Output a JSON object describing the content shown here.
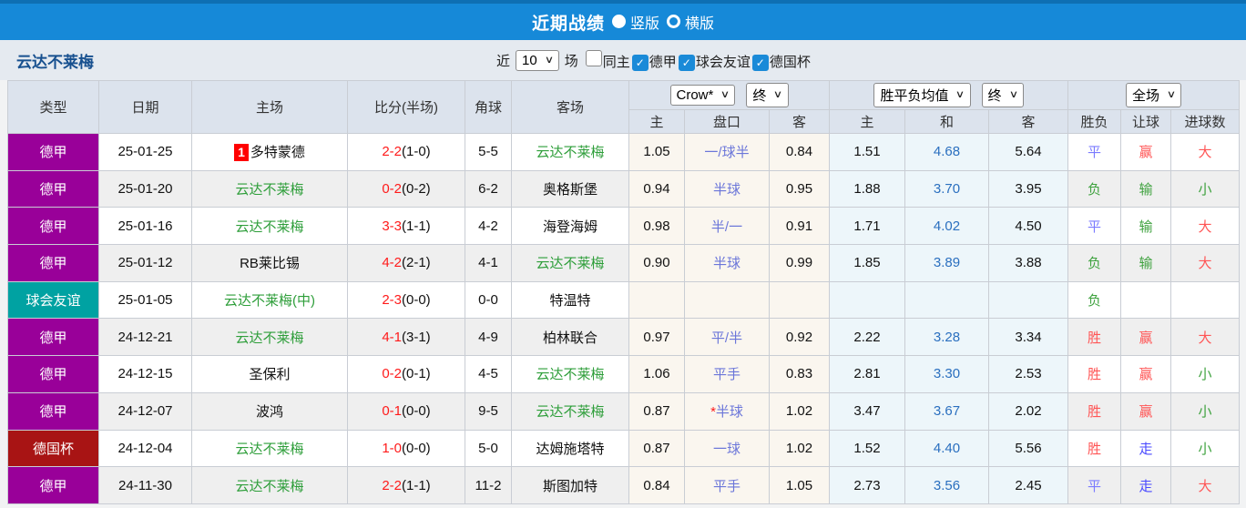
{
  "topbar": {
    "title": "近期战绩",
    "options": [
      {
        "label": "竖版",
        "selected": false
      },
      {
        "label": "横版",
        "selected": true
      }
    ]
  },
  "subheader": {
    "team": "云达不莱梅",
    "near_label": "近",
    "count_value": "10",
    "unit_label": "场",
    "filters": [
      {
        "label": "同主",
        "checked": false
      },
      {
        "label": "德甲",
        "checked": true
      },
      {
        "label": "球会友谊",
        "checked": true
      },
      {
        "label": "德国杯",
        "checked": true
      }
    ]
  },
  "table": {
    "selects": {
      "company": "Crow*",
      "final1": "终",
      "avg": "胜平负均值",
      "final2": "终",
      "scope": "全场"
    },
    "columns": [
      "类型",
      "日期",
      "主场",
      "比分(半场)",
      "角球",
      "客场",
      "主",
      "盘口",
      "客",
      "主",
      "和",
      "客",
      "胜负",
      "让球",
      "进球数"
    ],
    "rows": [
      {
        "type": "德甲",
        "date": "25-01-25",
        "home": "多特蒙德",
        "home_rank": "1",
        "home_self": false,
        "score": "2-2",
        "half": "(1-0)",
        "corners": "5-5",
        "away": "云达不莱梅",
        "away_self": true,
        "odds_home": "1.05",
        "handicap": "一/球半",
        "handicap_star": false,
        "odds_away": "0.84",
        "avg_home": "1.51",
        "avg_draw": "4.68",
        "avg_away": "5.64",
        "result": "平",
        "handicap_result": "赢",
        "goals": "大"
      },
      {
        "type": "德甲",
        "date": "25-01-20",
        "home": "云达不莱梅",
        "home_self": true,
        "score": "0-2",
        "half": "(0-2)",
        "corners": "6-2",
        "away": "奥格斯堡",
        "away_self": false,
        "odds_home": "0.94",
        "handicap": "半球",
        "handicap_star": false,
        "odds_away": "0.95",
        "avg_home": "1.88",
        "avg_draw": "3.70",
        "avg_away": "3.95",
        "result": "负",
        "handicap_result": "输",
        "goals": "小"
      },
      {
        "type": "德甲",
        "date": "25-01-16",
        "home": "云达不莱梅",
        "home_self": true,
        "score": "3-3",
        "half": "(1-1)",
        "corners": "4-2",
        "away": "海登海姆",
        "away_self": false,
        "odds_home": "0.98",
        "handicap": "半/一",
        "handicap_star": false,
        "odds_away": "0.91",
        "avg_home": "1.71",
        "avg_draw": "4.02",
        "avg_away": "4.50",
        "result": "平",
        "handicap_result": "输",
        "goals": "大"
      },
      {
        "type": "德甲",
        "date": "25-01-12",
        "home": "RB莱比锡",
        "home_self": false,
        "score": "4-2",
        "half": "(2-1)",
        "corners": "4-1",
        "away": "云达不莱梅",
        "away_self": true,
        "odds_home": "0.90",
        "handicap": "半球",
        "handicap_star": false,
        "odds_away": "0.99",
        "avg_home": "1.85",
        "avg_draw": "3.89",
        "avg_away": "3.88",
        "result": "负",
        "handicap_result": "输",
        "goals": "大"
      },
      {
        "type": "球会友谊",
        "date": "25-01-05",
        "home": "云达不莱梅(中)",
        "home_self": true,
        "score": "2-3",
        "half": "(0-0)",
        "corners": "0-0",
        "away": "特温特",
        "away_self": false,
        "odds_home": "",
        "handicap": "",
        "handicap_star": false,
        "odds_away": "",
        "avg_home": "",
        "avg_draw": "",
        "avg_away": "",
        "result": "负",
        "handicap_result": "",
        "goals": ""
      },
      {
        "type": "德甲",
        "date": "24-12-21",
        "home": "云达不莱梅",
        "home_self": true,
        "score": "4-1",
        "half": "(3-1)",
        "corners": "4-9",
        "away": "柏林联合",
        "away_self": false,
        "odds_home": "0.97",
        "handicap": "平/半",
        "handicap_star": false,
        "odds_away": "0.92",
        "avg_home": "2.22",
        "avg_draw": "3.28",
        "avg_away": "3.34",
        "result": "胜",
        "handicap_result": "赢",
        "goals": "大"
      },
      {
        "type": "德甲",
        "date": "24-12-15",
        "home": "圣保利",
        "home_self": false,
        "score": "0-2",
        "half": "(0-1)",
        "corners": "4-5",
        "away": "云达不莱梅",
        "away_self": true,
        "odds_home": "1.06",
        "handicap": "平手",
        "handicap_star": false,
        "odds_away": "0.83",
        "avg_home": "2.81",
        "avg_draw": "3.30",
        "avg_away": "2.53",
        "result": "胜",
        "handicap_result": "赢",
        "goals": "小"
      },
      {
        "type": "德甲",
        "date": "24-12-07",
        "home": "波鸿",
        "home_self": false,
        "score": "0-1",
        "half": "(0-0)",
        "corners": "9-5",
        "away": "云达不莱梅",
        "away_self": true,
        "odds_home": "0.87",
        "handicap": "半球",
        "handicap_star": true,
        "odds_away": "1.02",
        "avg_home": "3.47",
        "avg_draw": "3.67",
        "avg_away": "2.02",
        "result": "胜",
        "handicap_result": "赢",
        "goals": "小"
      },
      {
        "type": "德国杯",
        "date": "24-12-04",
        "home": "云达不莱梅",
        "home_self": true,
        "score": "1-0",
        "half": "(0-0)",
        "corners": "5-0",
        "away": "达姆施塔特",
        "away_self": false,
        "odds_home": "0.87",
        "handicap": "一球",
        "handicap_star": false,
        "odds_away": "1.02",
        "avg_home": "1.52",
        "avg_draw": "4.40",
        "avg_away": "5.56",
        "result": "胜",
        "handicap_result": "走",
        "goals": "小"
      },
      {
        "type": "德甲",
        "date": "24-11-30",
        "home": "云达不莱梅",
        "home_self": true,
        "score": "2-2",
        "half": "(1-1)",
        "corners": "11-2",
        "away": "斯图加特",
        "away_self": false,
        "odds_home": "0.84",
        "handicap": "平手",
        "handicap_star": false,
        "odds_away": "1.05",
        "avg_home": "2.73",
        "avg_draw": "3.56",
        "avg_away": "2.45",
        "result": "平",
        "handicap_result": "走",
        "goals": "大"
      }
    ]
  },
  "colors": {
    "bar_blue": "#1689D8",
    "bar_top_edge": "#0E6FB3",
    "subheader_bg": "#E5EAF0",
    "header_bg": "#DCE3ED",
    "team_title_navy": "#17508F",
    "league": {
      "德甲": "#990099",
      "球会友谊": "#00A2A2",
      "德国杯": "#A81414"
    },
    "value_colors": {
      "胜": "red",
      "平": "violet",
      "负": "green",
      "赢": "red",
      "输": "green",
      "走": "blue",
      "大": "red",
      "小": "green"
    },
    "checkbox_checked": "#1A8AD8",
    "team_green": "#2E9E3A",
    "score_red": "#FF1A1A",
    "handicap_text": "#6B76D9",
    "avg_draw_blue": "#2A6FBF",
    "odds_col_bg": "#FAF6EF",
    "avg_col_bg": "#EDF6FA",
    "rank_badge_bg": "#FF0000"
  }
}
